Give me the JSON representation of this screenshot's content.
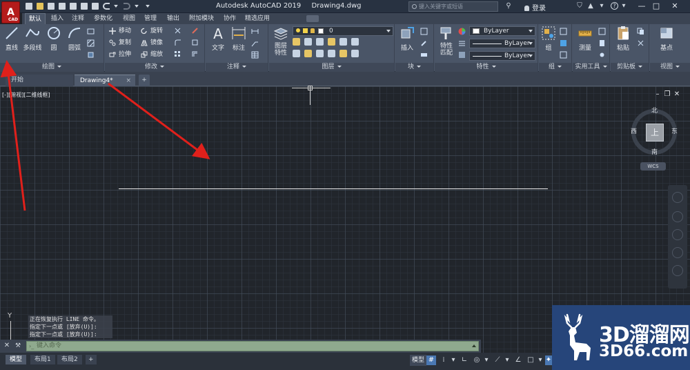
{
  "titlebar": {
    "app_button": "A",
    "app_button_sub": "CAD",
    "app_name": "Autodesk AutoCAD 2019",
    "file_name": "Drawing4.dwg",
    "search_placeholder": "键入关键字或短语",
    "login": "登录",
    "minimize": "—",
    "restore": "□",
    "close": "✕"
  },
  "ribbon_tabs": [
    "默认",
    "插入",
    "注释",
    "参数化",
    "视图",
    "管理",
    "输出",
    "附加模块",
    "协作",
    "精选应用"
  ],
  "ribbon": {
    "draw": {
      "label": "绘图",
      "line": "直线",
      "polyline": "多段线",
      "circle": "圆",
      "arc": "圆弧"
    },
    "modify": {
      "label": "修改",
      "move": "移动",
      "rotate": "旋转",
      "copy": "复制",
      "mirror": "镜像",
      "stretch": "拉伸",
      "scale": "缩放"
    },
    "annotation": {
      "label": "注释",
      "text": "文字",
      "dimension": "标注"
    },
    "layers": {
      "label": "图层",
      "layer_properties": "图层特性",
      "current_layer": "0"
    },
    "block": {
      "label": "块",
      "insert": "插入"
    },
    "properties": {
      "label": "特性",
      "match": "特性匹配",
      "color": "ByLayer",
      "linetype": "ByLayer",
      "lineweight": "ByLayer"
    },
    "groups": {
      "label": "组",
      "group": "组"
    },
    "utilities": {
      "label": "实用工具",
      "measure": "测量"
    },
    "clipboard": {
      "label": "剪贴板",
      "paste": "粘贴"
    },
    "view": {
      "label": "视图",
      "base": "基点"
    }
  },
  "doc_tabs": {
    "start": "开始",
    "drawing": "Drawing4*",
    "close": "×",
    "new": "+"
  },
  "viewport": {
    "label": "[-][俯视][二维线框]",
    "viewcube_top": "上",
    "north": "北",
    "south": "南",
    "east": "东",
    "west": "西",
    "wcs": "WCS",
    "ucs_y": "Y"
  },
  "command": {
    "history": [
      "正在恢复执行 LINE 命令。",
      "指定下一点或 [放弃(U)]:",
      "指定下一点或 [放弃(U)]:"
    ],
    "placeholder": "键入命令"
  },
  "layout_tabs": [
    "模型",
    "布局1",
    "布局2",
    "+"
  ],
  "status": {
    "model": "模型"
  },
  "watermark": {
    "brand": "3D溜溜网",
    "domain": "3D66.com"
  },
  "colors": {
    "accent_red": "#e0201b",
    "cmd_green": "#8fa98e",
    "watermark_blue": "#26457a"
  }
}
